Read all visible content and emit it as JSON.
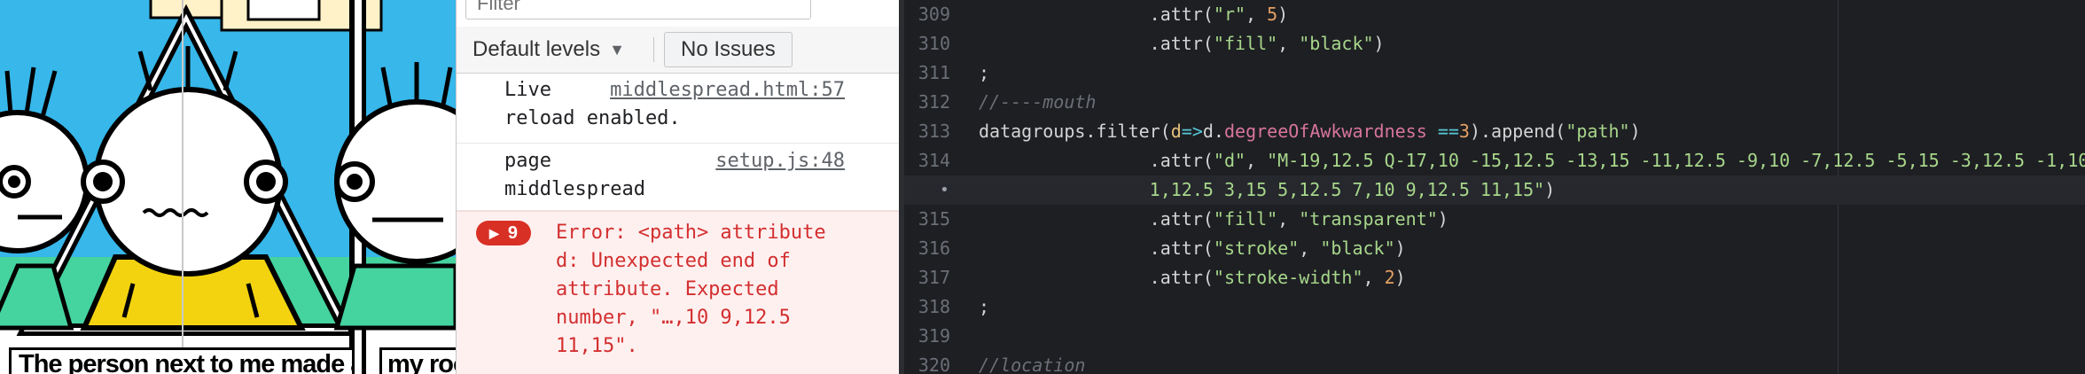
{
  "preview": {
    "caption": "The person next to me made an",
    "caption2": "my roo",
    "colors": {
      "sky": "#37b7ea",
      "green": "#45d3a0",
      "shirt": "#f3d310",
      "cream": "#fff2c8"
    }
  },
  "console": {
    "filter_placeholder": "Filter",
    "levels_label": "Default levels",
    "issues_label": "No Issues",
    "messages": [
      {
        "text_line1": "Live",
        "source": "middlespread.html:57",
        "text_line2": "reload enabled."
      },
      {
        "text_line1": "page",
        "source": "setup.js:48",
        "text_line2": "middlespread"
      }
    ],
    "error": {
      "count": "9",
      "lines": [
        "Error: <path> attribute",
        "d: Unexpected end of",
        "attribute. Expected",
        "number, \"…,10 9,12.5",
        "11,15\"."
      ]
    }
  },
  "editor": {
    "lines": [
      {
        "num": "309",
        "tokens": [
          [
            "c-plain",
            "                .attr("
          ],
          [
            "c-str",
            "\"r\""
          ],
          [
            "c-plain",
            ", "
          ],
          [
            "c-num",
            "5"
          ],
          [
            "c-plain",
            ")"
          ]
        ]
      },
      {
        "num": "310",
        "tokens": [
          [
            "c-plain",
            "                .attr("
          ],
          [
            "c-str",
            "\"fill\""
          ],
          [
            "c-plain",
            ", "
          ],
          [
            "c-str",
            "\"black\""
          ],
          [
            "c-plain",
            ")"
          ]
        ]
      },
      {
        "num": "311",
        "tokens": [
          [
            "c-plain",
            ";"
          ]
        ]
      },
      {
        "num": "312",
        "tokens": [
          [
            "c-com",
            "//----mouth"
          ]
        ]
      },
      {
        "num": "313",
        "tokens": [
          [
            "c-plain",
            "datagroups.filter("
          ],
          [
            "c-var",
            "d"
          ],
          [
            "c-op",
            "=>"
          ],
          [
            "c-plain",
            "d."
          ],
          [
            "c-kw",
            "degreeOfAwkwardness"
          ],
          [
            "c-plain",
            " "
          ],
          [
            "c-op",
            "=="
          ],
          [
            "c-num",
            "3"
          ],
          [
            "c-plain",
            ").append("
          ],
          [
            "c-str",
            "\"path\""
          ],
          [
            "c-plain",
            ")"
          ]
        ]
      },
      {
        "num": "314",
        "tokens": [
          [
            "c-plain",
            "                .attr("
          ],
          [
            "c-str",
            "\"d\""
          ],
          [
            "c-plain",
            ", "
          ],
          [
            "c-str",
            "\"M-19,12.5 Q-17,10 -15,12.5 -13,15 -11,12.5 -9,10 -7,12.5 -5,15 -3,12.5 -1,10"
          ]
        ]
      },
      {
        "num": "",
        "dot": "•",
        "active": true,
        "tokens": [
          [
            "c-str",
            "                1,12.5 3,15 5,12.5 7,10 9,12.5 11,15\""
          ],
          [
            "c-plain",
            ")"
          ]
        ]
      },
      {
        "num": "315",
        "tokens": [
          [
            "c-plain",
            "                .attr("
          ],
          [
            "c-str",
            "\"fill\""
          ],
          [
            "c-plain",
            ", "
          ],
          [
            "c-str",
            "\"transparent\""
          ],
          [
            "c-plain",
            ")"
          ]
        ]
      },
      {
        "num": "316",
        "tokens": [
          [
            "c-plain",
            "                .attr("
          ],
          [
            "c-str",
            "\"stroke\""
          ],
          [
            "c-plain",
            ", "
          ],
          [
            "c-str",
            "\"black\""
          ],
          [
            "c-plain",
            ")"
          ]
        ]
      },
      {
        "num": "317",
        "tokens": [
          [
            "c-plain",
            "                .attr("
          ],
          [
            "c-str",
            "\"stroke-width\""
          ],
          [
            "c-plain",
            ", "
          ],
          [
            "c-num",
            "2"
          ],
          [
            "c-plain",
            ")"
          ]
        ]
      },
      {
        "num": "318",
        "tokens": [
          [
            "c-plain",
            ";"
          ]
        ]
      },
      {
        "num": "319",
        "tokens": []
      },
      {
        "num": "320",
        "tokens": [
          [
            "c-com",
            "//location"
          ]
        ]
      }
    ]
  }
}
